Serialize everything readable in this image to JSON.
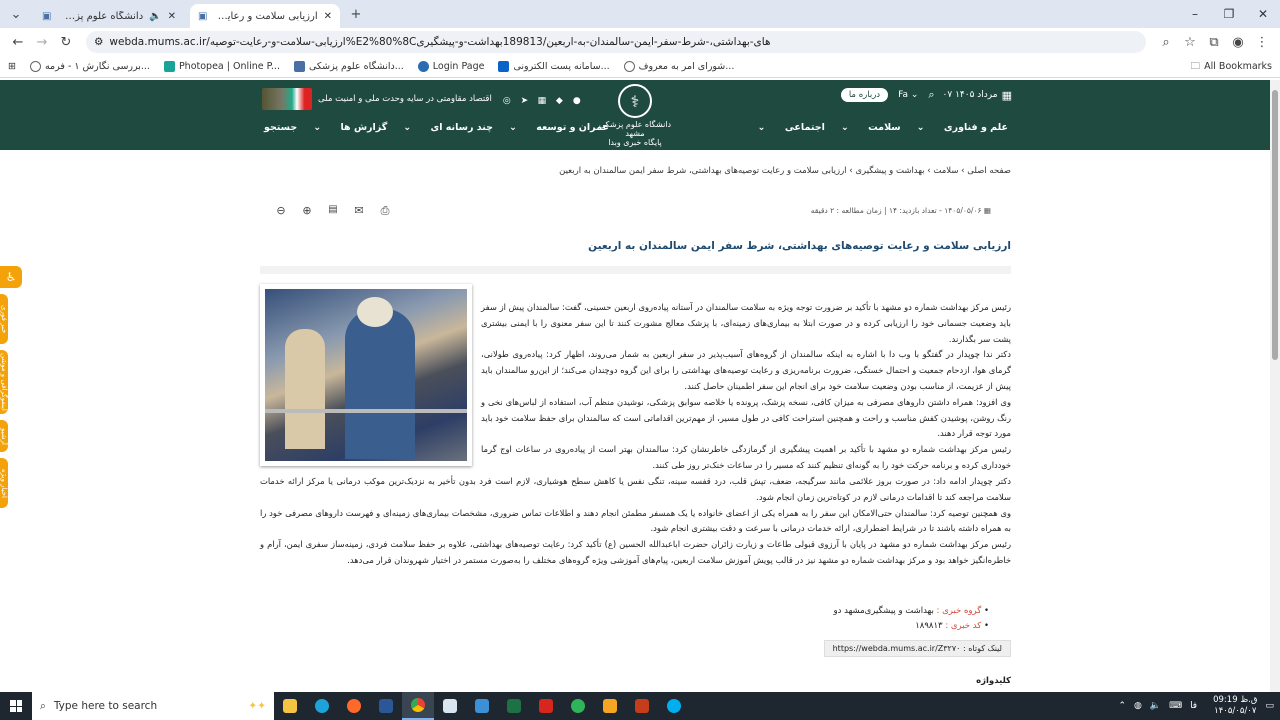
{
  "browser": {
    "tabs": [
      {
        "title": "دانشگاه علوم پزشکی مشهد",
        "active": false
      },
      {
        "title": "ارزیابی سلامت و رعایت توصیه‌ها",
        "active": true
      }
    ],
    "new_tab": "+",
    "url": "webda.mums.ac.ir/ارزیابی-سلامت-و-رعایت-توصیه%E2%80%8Cهای-بهداشتی،-شرط-سفر-ایمن-سالمندان-به-اربعین/189813بهداشت-و-پیشگیری",
    "bookmarks": [
      "بررسی نگارش ۱ - فرمه...",
      "Photopea | Online P...",
      "دانشگاه علوم پزشکی...",
      "Login Page",
      "سامانه پست الکترونی...",
      "شورای امر به معروف..."
    ],
    "all_bookmarks": "All Bookmarks"
  },
  "header": {
    "slogan": "اقتصاد مقاومتی در سایه وحدت ملی و امنیت ملی",
    "logo_line1": "دانشگاه علوم پزشکی مشهد",
    "logo_line2": "پایگاه خبری وبدا",
    "about": "درباره ما",
    "lang": "Fa",
    "date": "۰۷ مرداد ۱۴۰۵",
    "menu_right": [
      "علم و فناوری",
      "سلامت",
      "اجتماعی"
    ],
    "menu_left": [
      "عمران و توسعه",
      "چند رسانه ای",
      "گزارش ها",
      "جستجو"
    ]
  },
  "article": {
    "breadcrumb": "صفحه اصلی  ›  سلامت  ›  بهداشت و پیشگیری  ›  ارزیابی سلامت و رعایت توصیه‌های بهداشتی، شرط سفر ایمن سالمندان به اربعین",
    "meta": "۱۴۰۵/۰۵/۰۶  -  تعداد بازدید: ۱۴   |  زمان مطالعه : ۲ دقیقه",
    "title": "ارزیابی سلامت و رعایت توصیه‌های بهداشتی، شرط سفر ایمن سالمندان به اربعین",
    "paragraphs_narrow": [
      "رئیس مرکز بهداشت شماره دو مشهد با تأکید بر ضرورت توجه ویژه به سلامت سالمندان در آستانه پیاده‌روی اربعین حسینی، گفت: سالمندان پیش از سفر باید وضعیت جسمانی خود را ارزیابی کرده و در صورت ابتلا به بیماری‌های زمینه‌ای، با پزشک معالج مشورت کنند تا این سفر معنوی را با ایمنی بیشتری پشت سر بگذارند.",
      "دکتر ندا چوپدار در گفتگو با وب دا  با اشاره به اینکه سالمندان از گروه‌های آسیب‌پذیر در سفر اربعین به شمار می‌روند، اظهار کرد: پیاده‌روی طولانی، گرمای هوا، ازدحام جمعیت و احتمال خستگی، ضرورت برنامه‌ریزی و رعایت توصیه‌های بهداشتی را برای این گروه دوچندان می‌کند؛ از این‌رو سالمندان باید پیش از عزیمت، از مناسب بودن وضعیت سلامت خود برای انجام این سفر اطمینان حاصل کنند.",
      "وی افزود: همراه داشتن داروهای مصرفی به میزان کافی، نسخه پزشک، پرونده یا خلاصه سوابق پزشکی، نوشیدن منظم آب، استفاده از لباس‌های نخی و رنگ روشن، پوشیدن کفش مناسب و راحت و همچنین استراحت کافی در طول مسیر، از مهم‌ترین اقداماتی است که سالمندان برای حفظ سلامت خود باید مورد توجه قرار دهند.",
      "رئیس مرکز بهداشت شماره دو مشهد با تأکید بر اهمیت پیشگیری از گرمازدگی خاطرنشان کرد: سالمندان بهتر است از پیاده‌روی در ساعات اوج گرما خودداری کرده و برنامه حرکت خود را به گونه‌ای تنظیم کنند که مسیر را در ساعات خنک‌تر روز طی کنند."
    ],
    "paragraphs_wide": [
      "دکتر چوپدار ادامه داد: در صورت بروز علائمی مانند سرگیجه، ضعف، تپش قلب، درد قفسه سینه، تنگی نفس یا کاهش سطح هوشیاری، لازم است فرد بدون تأخیر به نزدیک‌ترین موکب درمانی یا مرکز ارائه خدمات سلامت مراجعه کند تا اقدامات درمانی لازم در کوتاه‌ترین زمان انجام شود.",
      "وی همچنین توصیه کرد: سالمندان حتی‌الامکان این سفر را به همراه یکی از اعضای خانواده یا یک همسفر مطمئن انجام دهند و اطلاعات تماس ضروری، مشخصات بیماری‌های زمینه‌ای و فهرست داروهای مصرفی خود را به همراه داشته باشند تا در شرایط اضطراری، ارائه خدمات درمانی با سرعت و دقت بیشتری انجام شود.",
      "رئیس مرکز بهداشت شماره دو مشهد در پایان با آرزوی قبولی طاعات و زیارت زائران حضرت اباعبدالله الحسین (ع) تأکید کرد: رعایت توصیه‌های بهداشتی، علاوه بر حفظ سلامت فردی، زمینه‌ساز سفری ایمن، آرام و خاطره‌انگیز خواهد بود و مرکز بهداشت شماره دو مشهد نیز در قالب پویش آموزش سلامت اربعین، پیام‌های آموزشی ویژه گروه‌های مختلف را به‌صورت مستمر در اختیار شهروندان قرار می‌دهد."
    ],
    "tag_group_label": "گروه خبری :",
    "tag_group_value": "بهداشت و پیشگیری‌مشهد دو",
    "tag_code_label": "کد خبری :",
    "tag_code_value": "۱۸۹۸۱۳",
    "short_link_label": "لینک کوتاه :",
    "short_link": "https://webda.mums.ac.ir/Z۳۲۷۰",
    "keywords": "کلیدواژه"
  },
  "side_buttons": [
    "",
    "خبر فوری",
    "اینفوگرافی و موشن",
    "آرشیو",
    "اخبار ویژه"
  ],
  "taskbar": {
    "search_placeholder": "Type here to search",
    "lang": "فا",
    "time": "09:19 ق.ظ",
    "date": "۱۴۰۵/۰۵/۰۷"
  }
}
